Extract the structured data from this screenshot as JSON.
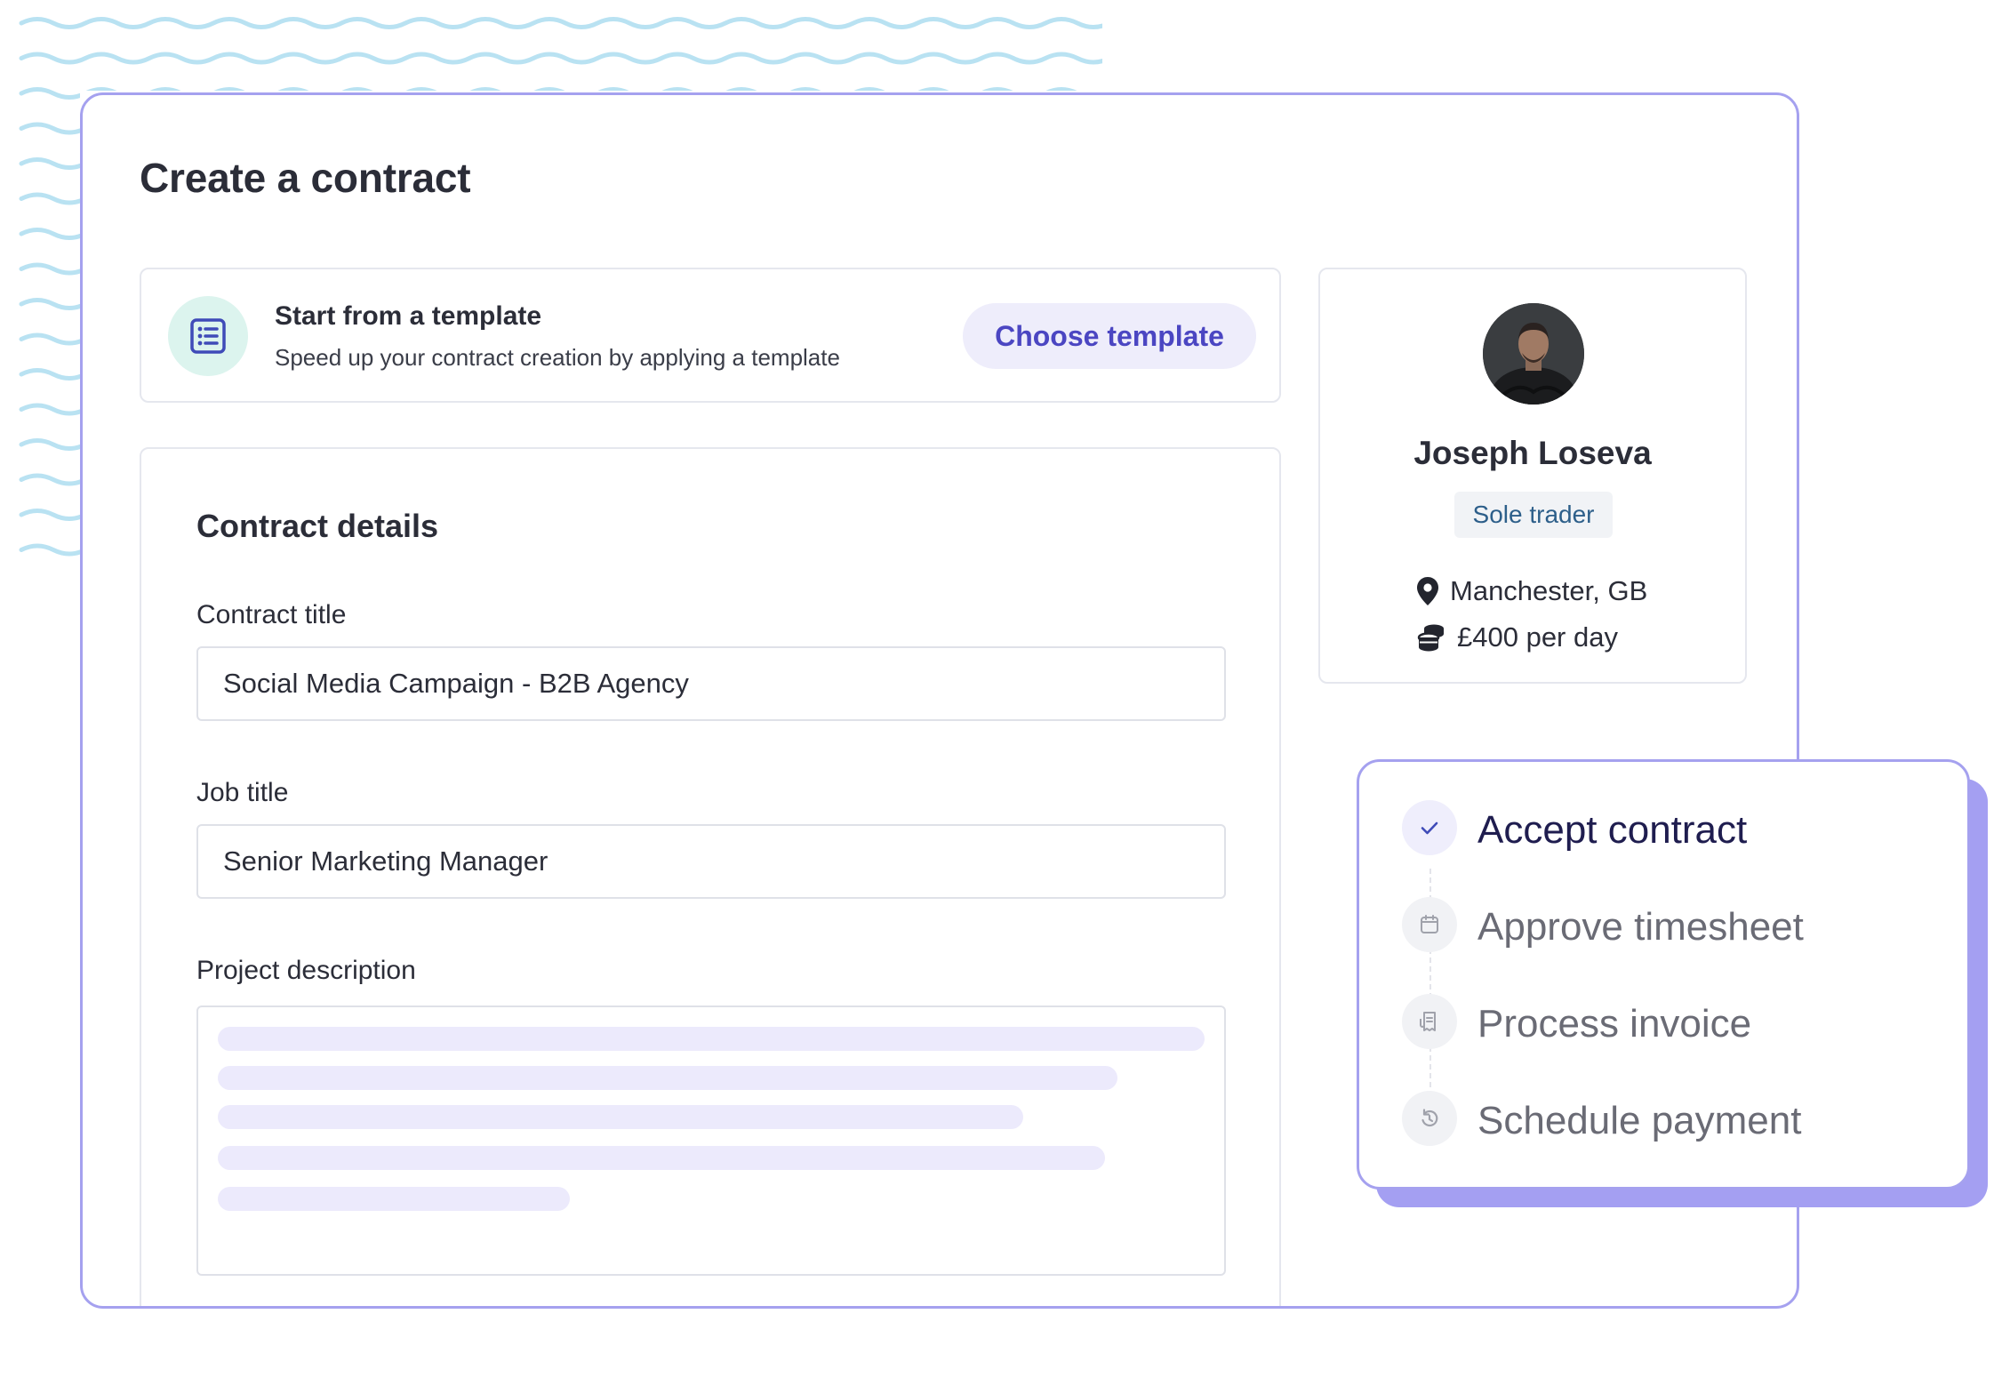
{
  "page": {
    "title": "Create a contract"
  },
  "template": {
    "title": "Start from a template",
    "subtitle": "Speed up your contract creation by applying a template",
    "button_label": "Choose template",
    "icon": "list-icon"
  },
  "details": {
    "heading": "Contract details",
    "contract_title_label": "Contract title",
    "contract_title_value": "Social Media Campaign - B2B Agency",
    "job_title_label": "Job title",
    "job_title_value": "Senior Marketing Manager",
    "description_label": "Project description"
  },
  "profile": {
    "name": "Joseph Loseva",
    "badge": "Sole trader",
    "location": "Manchester, GB",
    "rate": "£400 per day"
  },
  "steps": [
    {
      "label": "Accept contract",
      "icon": "check-icon",
      "active": true
    },
    {
      "label": "Approve timesheet",
      "icon": "calendar-icon",
      "active": false
    },
    {
      "label": "Process invoice",
      "icon": "invoice-icon",
      "active": false
    },
    {
      "label": "Schedule payment",
      "icon": "schedule-icon",
      "active": false
    }
  ],
  "colors": {
    "accent": "#4b46c2",
    "card_border": "#a5a1ef",
    "shadow": "#a49ff2",
    "waves": "#b9e2f2",
    "template_icon_bg": "#dcf4ee"
  }
}
